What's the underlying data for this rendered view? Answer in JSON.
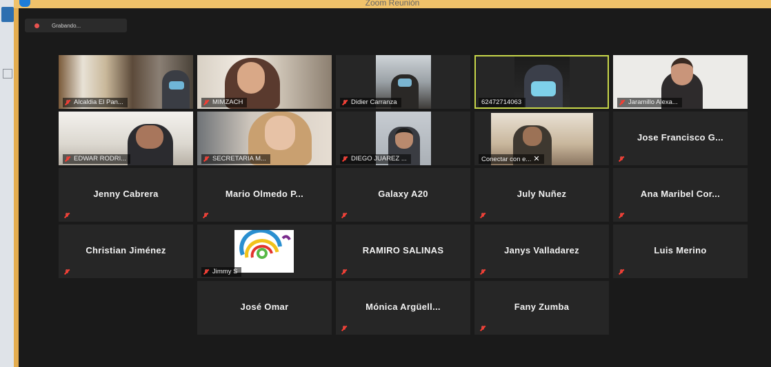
{
  "window": {
    "title": "Zoom Reunión"
  },
  "recording": {
    "label": "Grabando..."
  },
  "participants": [
    {
      "name": "Alcaldia El Pan...",
      "video": true,
      "muted": true
    },
    {
      "name": "MIMZACH",
      "video": true,
      "muted": true
    },
    {
      "name": "Didier Carranza",
      "video": true,
      "muted": true
    },
    {
      "name": "62472714063",
      "video": true,
      "muted": false,
      "active_speaker": true
    },
    {
      "name": "Jaramillo Alexa...",
      "video": true,
      "muted": true
    },
    {
      "name": "EDWAR RODRI...",
      "video": true,
      "muted": true
    },
    {
      "name": "SECRETARIA M...",
      "video": true,
      "muted": true
    },
    {
      "name": "DIEGO JUAREZ ...",
      "video": true,
      "muted": true
    },
    {
      "name": "Conectar con e...",
      "video": true,
      "muted": false,
      "connecting": true
    },
    {
      "name": "Jose Francisco G...",
      "video": false,
      "muted": true
    },
    {
      "name": "Jenny Cabrera",
      "video": false,
      "muted": true
    },
    {
      "name": "Mario Olmedo P...",
      "video": false,
      "muted": true
    },
    {
      "name": "Galaxy A20",
      "video": false,
      "muted": true
    },
    {
      "name": "July Nuñez",
      "video": false,
      "muted": true
    },
    {
      "name": "Ana Maribel Cor...",
      "video": false,
      "muted": true
    },
    {
      "name": "Christian Jiménez",
      "video": false,
      "muted": true
    },
    {
      "name": "Jimmy S",
      "video": false,
      "muted": true,
      "avatar": "logo"
    },
    {
      "name": "RAMIRO SALINAS",
      "video": false,
      "muted": true
    },
    {
      "name": "Janys Valladarez",
      "video": false,
      "muted": true
    },
    {
      "name": "Luis Merino",
      "video": false,
      "muted": true
    },
    {
      "name": "José Omar",
      "video": false,
      "muted": false
    },
    {
      "name": "Mónica Argüell...",
      "video": false,
      "muted": true
    },
    {
      "name": "Fany Zumba",
      "video": false,
      "muted": true
    }
  ],
  "icons": {
    "muted": "mic-muted-icon",
    "close": "close-icon",
    "recording": "recording-dot-icon"
  },
  "colors": {
    "active_border": "#c9d84a",
    "tile_bg": "#262626",
    "background": "#1a1a1a",
    "muted_red": "#e0463f"
  }
}
